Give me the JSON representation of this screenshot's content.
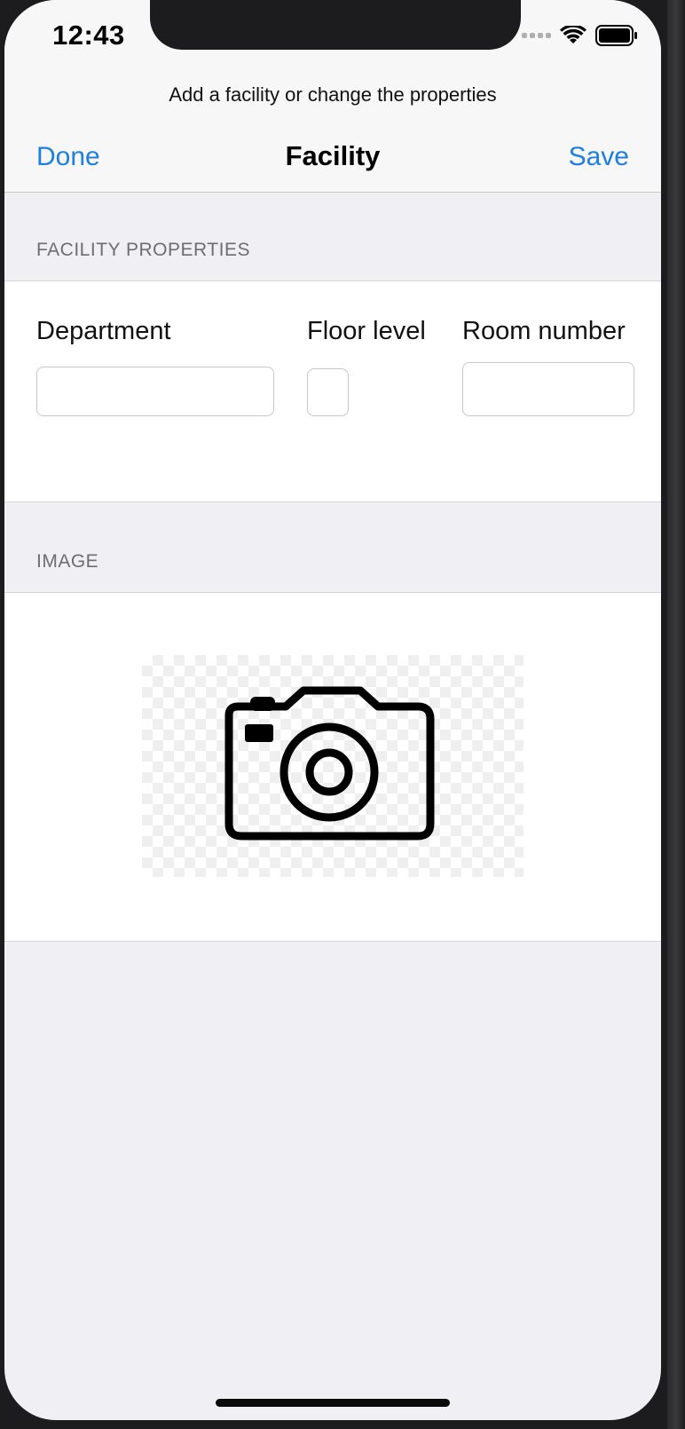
{
  "status_bar": {
    "time": "12:43",
    "icons": [
      "signal-dots-icon",
      "wifi-icon",
      "battery-icon"
    ]
  },
  "header": {
    "prompt": "Add  a facility or change the properties",
    "done_label": "Done",
    "title": "Facility",
    "save_label": "Save"
  },
  "facility_properties": {
    "section_title": "FACILITY PROPERTIES",
    "department_label": "Department",
    "department_value": "",
    "floor_level_label": "Floor level",
    "floor_level_value": "",
    "room_number_label": "Room number",
    "room_number_value": ""
  },
  "image_section": {
    "section_title": "IMAGE",
    "icon": "camera-icon"
  },
  "colors": {
    "accent": "#1e7fe0",
    "background": "#efeff4",
    "nav_background": "#f7f7f7",
    "section_header_text": "#6d6d72"
  }
}
